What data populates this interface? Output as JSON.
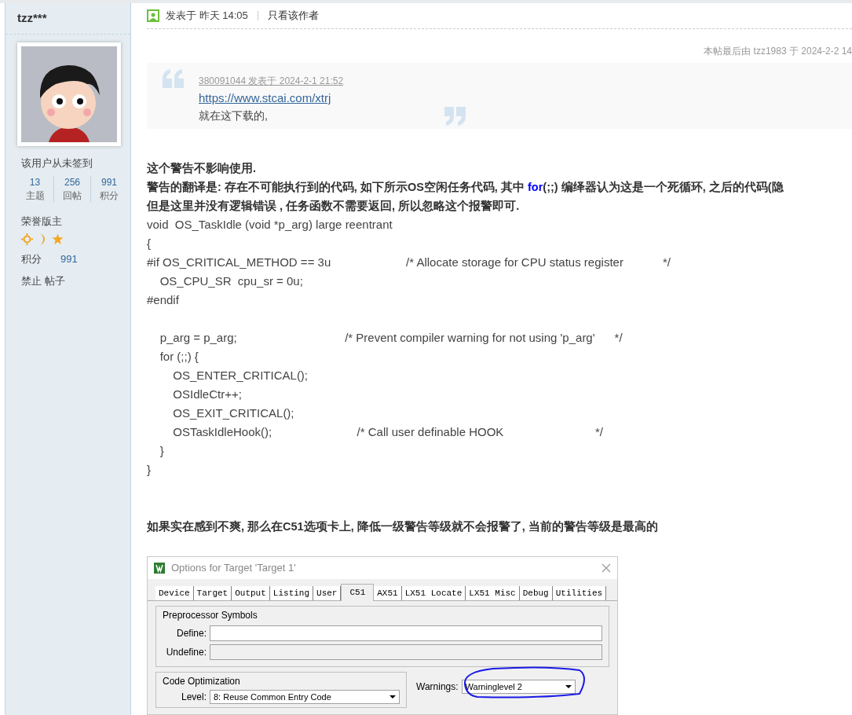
{
  "sidebar": {
    "username": "tzz***",
    "signin_status": "该用户从未签到",
    "stats": [
      {
        "value": "13",
        "label": "主题"
      },
      {
        "value": "256",
        "label": "回帖"
      },
      {
        "value": "991",
        "label": "积分"
      }
    ],
    "group": "荣誉版主",
    "points_label": "积分",
    "points_value": "991",
    "ban_link": "禁止 帖子"
  },
  "post": {
    "posted": "发表于 昨天 14:05",
    "author_only": "只看该作者",
    "edit_note": "本帖最后由 tzz1983 于 2024-2-2 14",
    "quote": {
      "meta": "380091044 发表于 2024-2-1 21:52",
      "link": "https://www.stcai.com/xtrj",
      "text": "就在这下载的,"
    },
    "paragraphs": [
      [
        {
          "text": "这个警告不影响使用."
        }
      ],
      [
        {
          "text": "警告的翻译是: 存在不可能执行到的代码,  如下所示OS空闲任务代码, 其中 "
        },
        {
          "text": "for",
          "kind": "keyword"
        },
        {
          "text": "(;;) 编绎器认为这是一个死循环, 之后的代码(隐"
        }
      ],
      [
        {
          "text": "但是这里并没有逻辑错误 , 任务函数不需要返回, 所以忽略这个报警即可."
        }
      ]
    ],
    "code_blocks": [
      [
        "void  OS_TaskIdle (void *p_arg) large reentrant",
        "{",
        "#if OS_CRITICAL_METHOD == 3u                       /* Allocate storage for CPU status register            */",
        "    OS_CPU_SR  cpu_sr = 0u;",
        "#endif"
      ],
      [
        "    p_arg = p_arg;                                 /* Prevent compiler warning for not using 'p_arg'      */",
        "    for (;;) {",
        "        OS_ENTER_CRITICAL();",
        "        OSIdleCtr++;",
        "        OS_EXIT_CRITICAL();",
        "        OSTaskIdleHook();                          /* Call user definable HOOK                            */",
        "    }",
        "}"
      ]
    ],
    "closing": "如果实在感到不爽, 那么在C51选项卡上, 降低一级警告等级就不会报警了, 当前的警告等级是最高的",
    "dialog": {
      "title": "Options for Target 'Target 1'",
      "tabs": [
        {
          "label": "Device",
          "selected": false
        },
        {
          "label": "Target",
          "selected": false
        },
        {
          "label": "Output",
          "selected": false
        },
        {
          "label": "Listing",
          "selected": false
        },
        {
          "label": "User",
          "selected": false
        },
        {
          "label": "C51",
          "selected": true
        },
        {
          "label": "AX51",
          "selected": false
        },
        {
          "label": "LX51 Locate",
          "selected": false
        },
        {
          "label": "LX51 Misc",
          "selected": false
        },
        {
          "label": "Debug",
          "selected": false
        },
        {
          "label": "Utilities",
          "selected": false
        }
      ],
      "preprocessor": {
        "title": "Preprocessor Symbols",
        "define_label": "Define:",
        "undefine_label": "Undefine:",
        "undefine_disabled": true
      },
      "optimization": {
        "title": "Code Optimization",
        "level_label": "Level:",
        "level_value": "8: Reuse Common Entry Code"
      },
      "warnings": {
        "label": "Warnings:",
        "value": "Warninglevel 2"
      }
    }
  }
}
